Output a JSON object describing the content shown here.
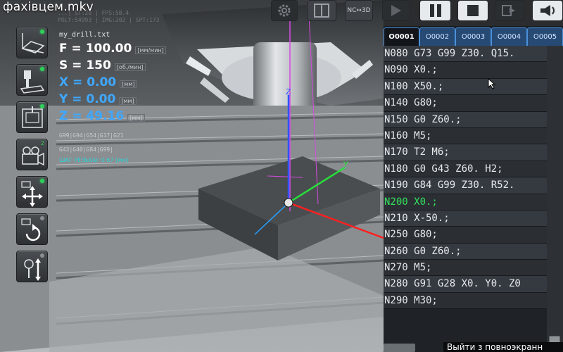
{
  "video_title": "фахівцем.mkv",
  "stats": [
    "...| ST:20 | FPS:58.4",
    "POLY:54993 | IMG:202 | SPT:173"
  ],
  "toolbar": {
    "buttons": [
      {
        "name": "settings",
        "icon": "gear-icon"
      },
      {
        "name": "machine-view",
        "icon": "machine-door-icon"
      },
      {
        "name": "nc-3d",
        "label": "NC↔3D"
      },
      {
        "name": "play",
        "icon": "play-icon"
      },
      {
        "name": "pause",
        "icon": "pause-icon"
      },
      {
        "name": "stop",
        "icon": "stop-icon"
      },
      {
        "name": "exit",
        "icon": "exit-icon"
      },
      {
        "name": "sound",
        "icon": "megaphone-icon"
      }
    ]
  },
  "readouts": {
    "filename": "my_drill.txt",
    "feed": {
      "value": "F = 100.00",
      "unit": "[мм/мин]"
    },
    "speed": {
      "value": "S = 150",
      "unit": "[об./мин]"
    },
    "x": {
      "value": "X = 0.00",
      "unit": "[мм]"
    },
    "y": {
      "value": "Y = 0.00",
      "unit": "[мм]"
    },
    "z": {
      "value": "Z = 49.16",
      "unit": "[мм]"
    },
    "modal_codes_1": "G99|G94|G54|G17|G21",
    "modal_codes_2": "G43|G40|G84|G99|",
    "thread_pitch": "ШАГ РЕЗЬБЫ: 0.67 [мм]"
  },
  "sidebar": {
    "tools": [
      {
        "name": "workpiece-setup",
        "icon": "workpiece-icon",
        "indicator": "green"
      },
      {
        "name": "tool-setup",
        "icon": "tool-icon",
        "indicator": "green"
      },
      {
        "name": "machine-setup",
        "icon": "machine-icon",
        "indicator": "green"
      },
      {
        "name": "camera-2",
        "icon": "camera-icon",
        "indicator": "2"
      },
      {
        "name": "camera-move",
        "icon": "camera-move-icon",
        "indicator": "green"
      },
      {
        "name": "camera-rotate",
        "icon": "camera-rotate-icon",
        "indicator": "grey"
      },
      {
        "name": "camera-zoom",
        "icon": "camera-zoom-icon",
        "indicator": "grey"
      }
    ]
  },
  "axes": {
    "x": "X",
    "y": "Y",
    "z": "Z"
  },
  "program": {
    "tabs": [
      "O0001",
      "O0002",
      "O0003",
      "O0004",
      "O0005"
    ],
    "active_tab": 0,
    "lines": [
      "N080 G73 G99 Z30. Q15.",
      "N090 X0.;",
      "N100 X50.;",
      "N140 G80;",
      "N150 G0 Z60.;",
      "N160 M5;",
      "N170 T2 M6;",
      "N180 G0 G43 Z60. H2;",
      "N190 G84 G99 Z30. R52.",
      "N200 X0.;",
      "N210 X-50.;",
      "N250 G80;",
      "N260 G0 Z60.;",
      "N270 M5;",
      "N280 G91 G28 X0. Y0. Z0",
      "N290 M30;"
    ],
    "current_line": 9
  },
  "fullscreen_hint": "Выйти з повноэкранн"
}
